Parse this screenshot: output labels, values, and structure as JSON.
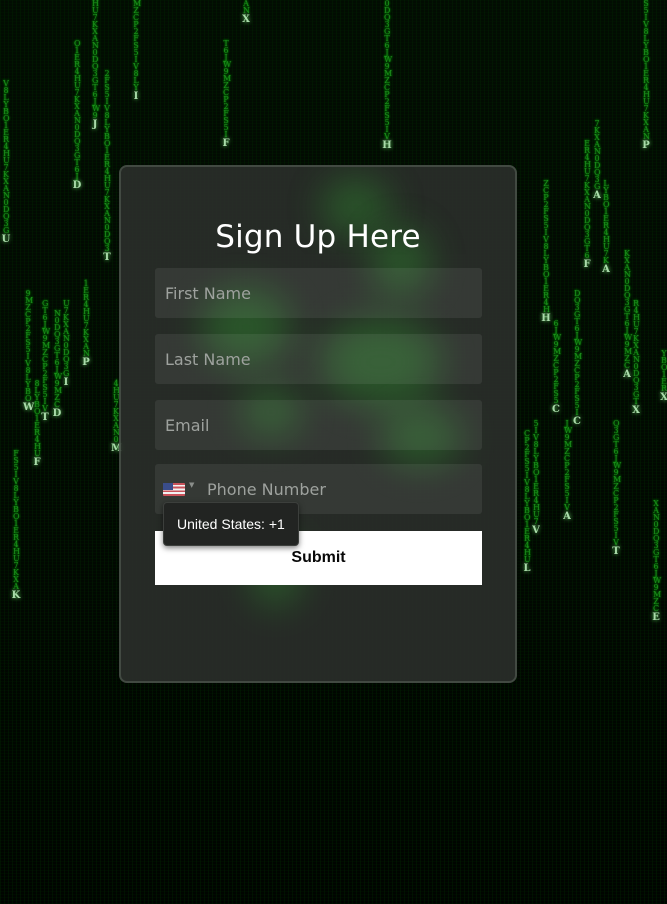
{
  "form": {
    "title": "Sign Up Here",
    "first_name_placeholder": "First Name",
    "last_name_placeholder": "Last Name",
    "email_placeholder": "Email",
    "phone_placeholder": "Phone Number",
    "country_tooltip": "United States: +1",
    "submit_label": "Submit"
  },
  "colors": {
    "rain_green": "#1fa81f",
    "card_background": "#2c302c",
    "submit_background": "#ffffff"
  },
  "rain": [
    {
      "head": "X"
    },
    {
      "head": "J"
    },
    {
      "head": "D"
    },
    {
      "head": "U"
    },
    {
      "head": "T"
    },
    {
      "head": "W"
    },
    {
      "head": "T"
    },
    {
      "head": "D"
    },
    {
      "head": "I"
    },
    {
      "head": "P"
    },
    {
      "head": "F"
    },
    {
      "head": "K"
    },
    {
      "head": "I"
    },
    {
      "head": "F"
    },
    {
      "head": "H"
    },
    {
      "head": "A"
    },
    {
      "head": "F"
    },
    {
      "head": "A"
    },
    {
      "head": "P"
    },
    {
      "head": "H"
    },
    {
      "head": "C"
    },
    {
      "head": "C"
    },
    {
      "head": "A"
    },
    {
      "head": "X"
    },
    {
      "head": "X"
    },
    {
      "head": "V"
    },
    {
      "head": "L"
    },
    {
      "head": "A"
    },
    {
      "head": "T"
    },
    {
      "head": "E"
    },
    {
      "head": "M"
    }
  ]
}
